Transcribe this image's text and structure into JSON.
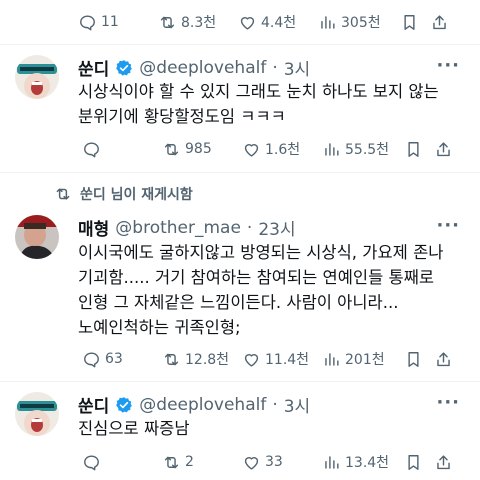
{
  "top_actions": {
    "replies": "11",
    "retweets": "8.3천",
    "likes": "4.4천",
    "views": "305천"
  },
  "tweet1": {
    "name": "쑨디",
    "handle": "@deeplovehalf",
    "dot": "·",
    "time": "3시",
    "text": "시상식이야 할 수 있지 그래도 눈치 하나도 보지 않는\n분위기에 황당할정도임 ㅋㅋㅋ",
    "actions": {
      "replies": "",
      "retweets": "985",
      "likes": "1.6천",
      "views": "55.5천"
    }
  },
  "retweet_header": {
    "label": "쑨디 님이 재게시함"
  },
  "tweet2": {
    "name": "매형",
    "handle": "@brother_mae",
    "dot": "·",
    "time": "23시",
    "text": "이시국에도 굴하지않고 방영되는 시상식, 가요제 존나\n기괴함..... 거기 참여하는 참여되는 연예인들 통째로\n인형 그 자체같은 느낌이든다. 사람이 아니라...\n노예인척하는 귀족인형;",
    "actions": {
      "replies": "63",
      "retweets": "12.8천",
      "likes": "11.4천",
      "views": "201천"
    }
  },
  "tweet3": {
    "name": "쑨디",
    "handle": "@deeplovehalf",
    "dot": "·",
    "time": "3시",
    "text": "진심으로 짜증남",
    "actions": {
      "replies": "",
      "retweets": "2",
      "likes": "33",
      "views": "13.4천"
    }
  },
  "more_label": "···",
  "colors": {
    "verified": "#1d9bf0",
    "muted": "#536471",
    "divider": "#eff3f4"
  }
}
